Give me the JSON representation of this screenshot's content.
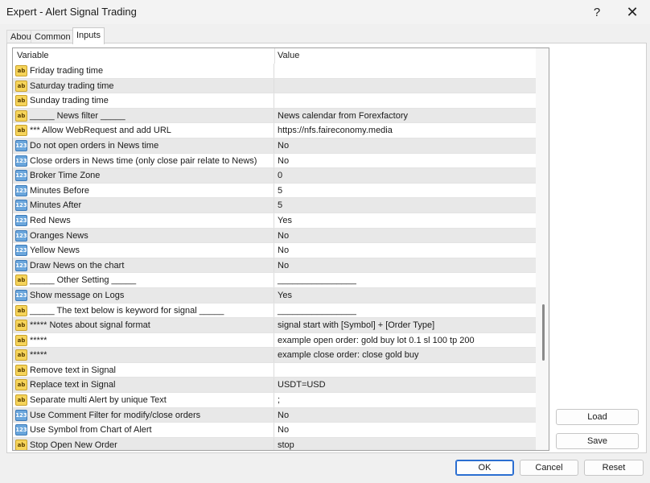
{
  "window": {
    "title": "Expert - Alert Signal Trading",
    "help_glyph": "?",
    "close_glyph": "✕"
  },
  "tabs": [
    {
      "label": "About",
      "active": false
    },
    {
      "label": "Common",
      "active": false
    },
    {
      "label": "Inputs",
      "active": true
    }
  ],
  "grid": {
    "columns": {
      "variable": "Variable",
      "value": "Value"
    },
    "rows": [
      {
        "icon": "ab",
        "variable": "Friday trading time",
        "value": ""
      },
      {
        "icon": "ab",
        "variable": "Saturday trading time",
        "value": ""
      },
      {
        "icon": "ab",
        "variable": "Sunday trading time",
        "value": ""
      },
      {
        "icon": "ab",
        "variable": "_____ News filter _____",
        "value": "News calendar from Forexfactory"
      },
      {
        "icon": "ab",
        "variable": "*** Allow WebRequest and add URL",
        "value": "https://nfs.faireconomy.media"
      },
      {
        "icon": "123",
        "variable": "Do not open orders in News time",
        "value": "No"
      },
      {
        "icon": "123",
        "variable": "Close orders in News time (only close pair relate to News)",
        "value": "No"
      },
      {
        "icon": "123",
        "variable": "Broker Time Zone",
        "value": "0"
      },
      {
        "icon": "123",
        "variable": "Minutes Before",
        "value": "5"
      },
      {
        "icon": "123",
        "variable": "Minutes After",
        "value": "5"
      },
      {
        "icon": "123",
        "variable": "Red News",
        "value": "Yes"
      },
      {
        "icon": "123",
        "variable": "Oranges News",
        "value": "No"
      },
      {
        "icon": "123",
        "variable": "Yellow News",
        "value": "No"
      },
      {
        "icon": "123",
        "variable": "Draw News on the chart",
        "value": "No"
      },
      {
        "icon": "ab",
        "variable": "_____ Other Setting _____",
        "value": "________________"
      },
      {
        "icon": "123",
        "variable": "Show message on Logs",
        "value": "Yes"
      },
      {
        "icon": "ab",
        "variable": "_____ The text below is keyword for signal _____",
        "value": "________________"
      },
      {
        "icon": "ab",
        "variable": "***** Notes about signal format",
        "value": "signal start with [Symbol] + [Order Type]"
      },
      {
        "icon": "ab",
        "variable": "*****",
        "value": "example open order: gold buy lot 0.1 sl 100 tp 200"
      },
      {
        "icon": "ab",
        "variable": "*****",
        "value": "example close order: close gold buy"
      },
      {
        "icon": "ab",
        "variable": "Remove text in Signal",
        "value": ""
      },
      {
        "icon": "ab",
        "variable": "Replace text in Signal",
        "value": "USDT=USD"
      },
      {
        "icon": "ab",
        "variable": "Separate multi Alert by unique Text",
        "value": ";"
      },
      {
        "icon": "123",
        "variable": "Use Comment Filter for modify/close orders",
        "value": "No"
      },
      {
        "icon": "123",
        "variable": "Use Symbol from Chart of Alert",
        "value": "No"
      },
      {
        "icon": "ab",
        "variable": "Stop Open New Order",
        "value": "stop"
      }
    ]
  },
  "side_buttons": {
    "load": "Load",
    "save": "Save"
  },
  "footer_buttons": {
    "ok": "OK",
    "cancel": "Cancel",
    "reset": "Reset"
  }
}
